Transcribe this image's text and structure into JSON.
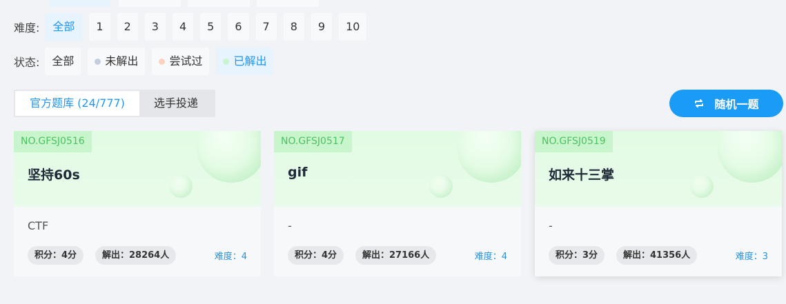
{
  "difficulty": {
    "label": "难度:",
    "options": [
      "全部",
      "1",
      "2",
      "3",
      "4",
      "5",
      "6",
      "7",
      "8",
      "9",
      "10"
    ],
    "selected": "全部"
  },
  "status": {
    "label": "状态:",
    "options": [
      {
        "label": "全部",
        "dot_color": ""
      },
      {
        "label": "未解出",
        "dot_color": "#c5cee0"
      },
      {
        "label": "尝试过",
        "dot_color": "#fcd3c1"
      },
      {
        "label": "已解出",
        "dot_color": "#c8f5cd"
      }
    ],
    "selected": "已解出"
  },
  "tabs": [
    {
      "label": "官方题库 (24/777)",
      "active": true
    },
    {
      "label": "选手投递",
      "active": false
    }
  ],
  "random_button": {
    "label": "随机一题",
    "icon": "shuffle-icon"
  },
  "cards": [
    {
      "no": "NO.GFSJ0516",
      "title": "坚持60s",
      "category": "CTF",
      "score": "积分：4分",
      "solves": "解出：28264人",
      "difficulty": "难度：4"
    },
    {
      "no": "NO.GFSJ0517",
      "title": "gif",
      "category": "-",
      "score": "积分：4分",
      "solves": "解出：27166人",
      "difficulty": "难度：4"
    },
    {
      "no": "NO.GFSJ0519",
      "title": "如来十三掌",
      "category": "-",
      "score": "积分：3分",
      "solves": "解出：41356人",
      "difficulty": "难度：3"
    }
  ],
  "colors": {
    "accent": "#2196f3",
    "button": "#1a9bf5",
    "card_header": "#e2fbe3",
    "card_no_bg": "#c9f5cc",
    "card_no_text": "#4cc163"
  }
}
